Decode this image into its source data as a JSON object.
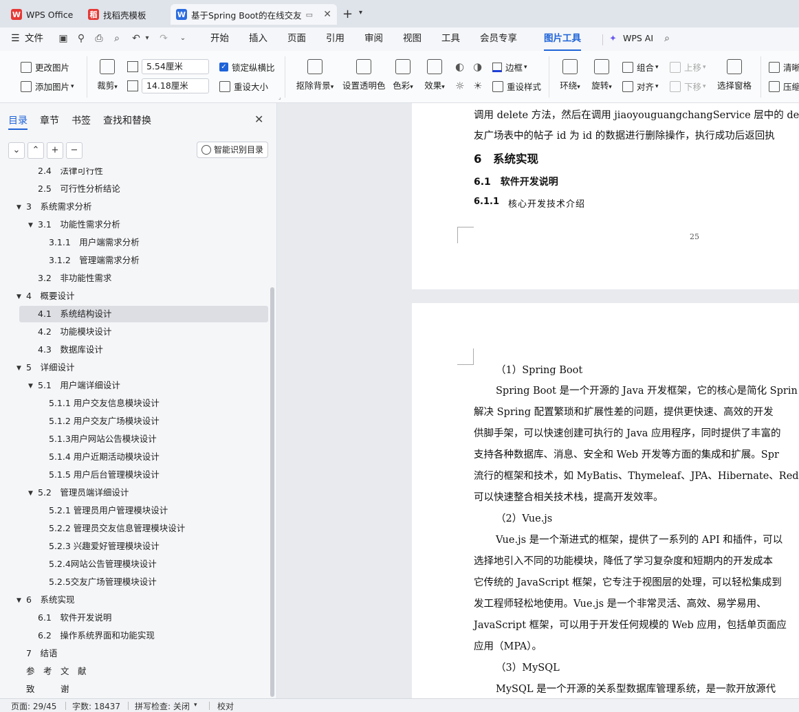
{
  "tabs": [
    {
      "label": "WPS Office",
      "icon": "wps-logo"
    },
    {
      "label": "找稻壳模板",
      "icon": "docer-logo"
    },
    {
      "label": "基于Spring Boot的在线交友",
      "icon": "writer-logo"
    }
  ],
  "menu": {
    "file": "文件",
    "items": [
      "开始",
      "插入",
      "页面",
      "引用",
      "审阅",
      "视图",
      "工具",
      "会员专享",
      "图片工具"
    ],
    "active": "图片工具",
    "wps_ai": "WPS AI"
  },
  "ribbon": {
    "change_image": "更改图片",
    "add_image": "添加图片",
    "crop": "裁剪",
    "width_value": "5.54厘米",
    "height_value": "14.18厘米",
    "lock_ratio": "锁定纵横比",
    "resize": "重设大小",
    "remove_bg": "抠除背景",
    "set_transparent": "设置透明色",
    "color": "色彩",
    "effect": "效果",
    "border": "边框",
    "reset_style": "重设样式",
    "wrap": "环绕",
    "rotate": "旋转",
    "group": "组合",
    "align": "对齐",
    "move_up": "上移",
    "move_down": "下移",
    "select_pane": "选择窗格",
    "clear": "清晰",
    "compress": "压缩"
  },
  "panel": {
    "tabs": [
      "目录",
      "章节",
      "书签",
      "查找和替换"
    ],
    "smart_toc": "智能识别目录",
    "toc": [
      {
        "text": "2.4　法律可行性",
        "level": 2,
        "tri": false
      },
      {
        "text": "2.5　可行性分析结论",
        "level": 2,
        "tri": false
      },
      {
        "text": "3　系统需求分析",
        "level": 1,
        "tri": true
      },
      {
        "text": "3.1　功能性需求分析",
        "level": 2,
        "tri": true
      },
      {
        "text": "3.1.1　用户端需求分析",
        "level": 3,
        "tri": false
      },
      {
        "text": "3.1.2　管理端需求分析",
        "level": 3,
        "tri": false
      },
      {
        "text": "3.2　非功能性需求",
        "level": 2,
        "tri": false
      },
      {
        "text": "4　概要设计",
        "level": 1,
        "tri": true
      },
      {
        "text": "4.1　系统结构设计",
        "level": 2,
        "tri": false,
        "selected": true
      },
      {
        "text": "4.2　功能模块设计",
        "level": 2,
        "tri": false
      },
      {
        "text": "4.3　数据库设计",
        "level": 2,
        "tri": false
      },
      {
        "text": "5　详细设计",
        "level": 1,
        "tri": true
      },
      {
        "text": "5.1　用户端详细设计",
        "level": 2,
        "tri": true
      },
      {
        "text": "5.1.1 用户交友信息模块设计",
        "level": 3,
        "tri": false
      },
      {
        "text": "5.1.2 用户交友广场模块设计",
        "level": 3,
        "tri": false
      },
      {
        "text": "5.1.3用户网站公告模块设计",
        "level": 3,
        "tri": false
      },
      {
        "text": "5.1.4 用户近期活动模块设计",
        "level": 3,
        "tri": false
      },
      {
        "text": "5.1.5 用户后台管理模块设计",
        "level": 3,
        "tri": false
      },
      {
        "text": "5.2　管理员端详细设计",
        "level": 2,
        "tri": true
      },
      {
        "text": "5.2.1 管理员用户管理模块设计",
        "level": 3,
        "tri": false
      },
      {
        "text": "5.2.2 管理员交友信息管理模块设计",
        "level": 3,
        "tri": false
      },
      {
        "text": "5.2.3 兴趣爱好管理模块设计",
        "level": 3,
        "tri": false
      },
      {
        "text": "5.2.4网站公告管理模块设计",
        "level": 3,
        "tri": false
      },
      {
        "text": "5.2.5交友广场管理模块设计",
        "level": 3,
        "tri": false
      },
      {
        "text": "6　系统实现",
        "level": 1,
        "tri": true
      },
      {
        "text": "6.1　软件开发说明",
        "level": 2,
        "tri": false
      },
      {
        "text": "6.2　操作系统界面和功能实现",
        "level": 2,
        "tri": false
      },
      {
        "text": "7　结语",
        "level": 1,
        "tri": false
      },
      {
        "text": "参　考　文　献",
        "level": 1,
        "tri": false
      },
      {
        "text": "致　　　谢",
        "level": 1,
        "tri": false
      }
    ]
  },
  "doc": {
    "page1_lines": [
      "调用 delete 方法，然后在调用 jiaoyouguangchangService 层中的 delete",
      "友广场表中的帖子 id 为 id 的数据进行删除操作，执行成功后返回执"
    ],
    "h1": "6　系统实现",
    "h2": "6.1　软件开发说明",
    "h3_num": "6.1.1",
    "h3_text": "核心开发技术介绍",
    "page_number": "25",
    "page2_lines": [
      "（1）Spring Boot",
      "Spring Boot 是一个开源的 Java 开发框架，它的核心是简化 Sprin",
      "解决 Spring 配置繁琐和扩展性差的问题，提供更快速、高效的开发",
      "供脚手架，可以快速创建可执行的 Java 应用程序，同时提供了丰富的",
      "支持各种数据库、消息、安全和 Web 开发等方面的集成和扩展。Spr",
      "流行的框架和技术，如 MyBatis、Thymeleaf、JPA、Hibernate、Redis",
      "可以快速整合相关技术栈，提高开发效率。",
      "（2）Vue.js",
      "Vue.js 是一个渐进式的框架，提供了一系列的 API 和插件，可以",
      "选择地引入不同的功能模块，降低了学习复杂度和短期内的开发成本",
      "它传统的 JavaScript 框架，它专注于视图层的处理，可以轻松集成到",
      "发工程师轻松地使用。Vue.js 是一个非常灵活、高效、易学易用、",
      "JavaScript 框架，可以用于开发任何规模的 Web 应用，包括单页面应",
      "应用（MPA）。",
      "（3）MySQL",
      "MySQL 是一个开源的关系型数据库管理系统，是一款开放源代"
    ]
  },
  "status": {
    "page": "页面: 29/45",
    "words": "字数: 18437",
    "spell": "拼写检查: 关闭",
    "proof": "校对"
  }
}
